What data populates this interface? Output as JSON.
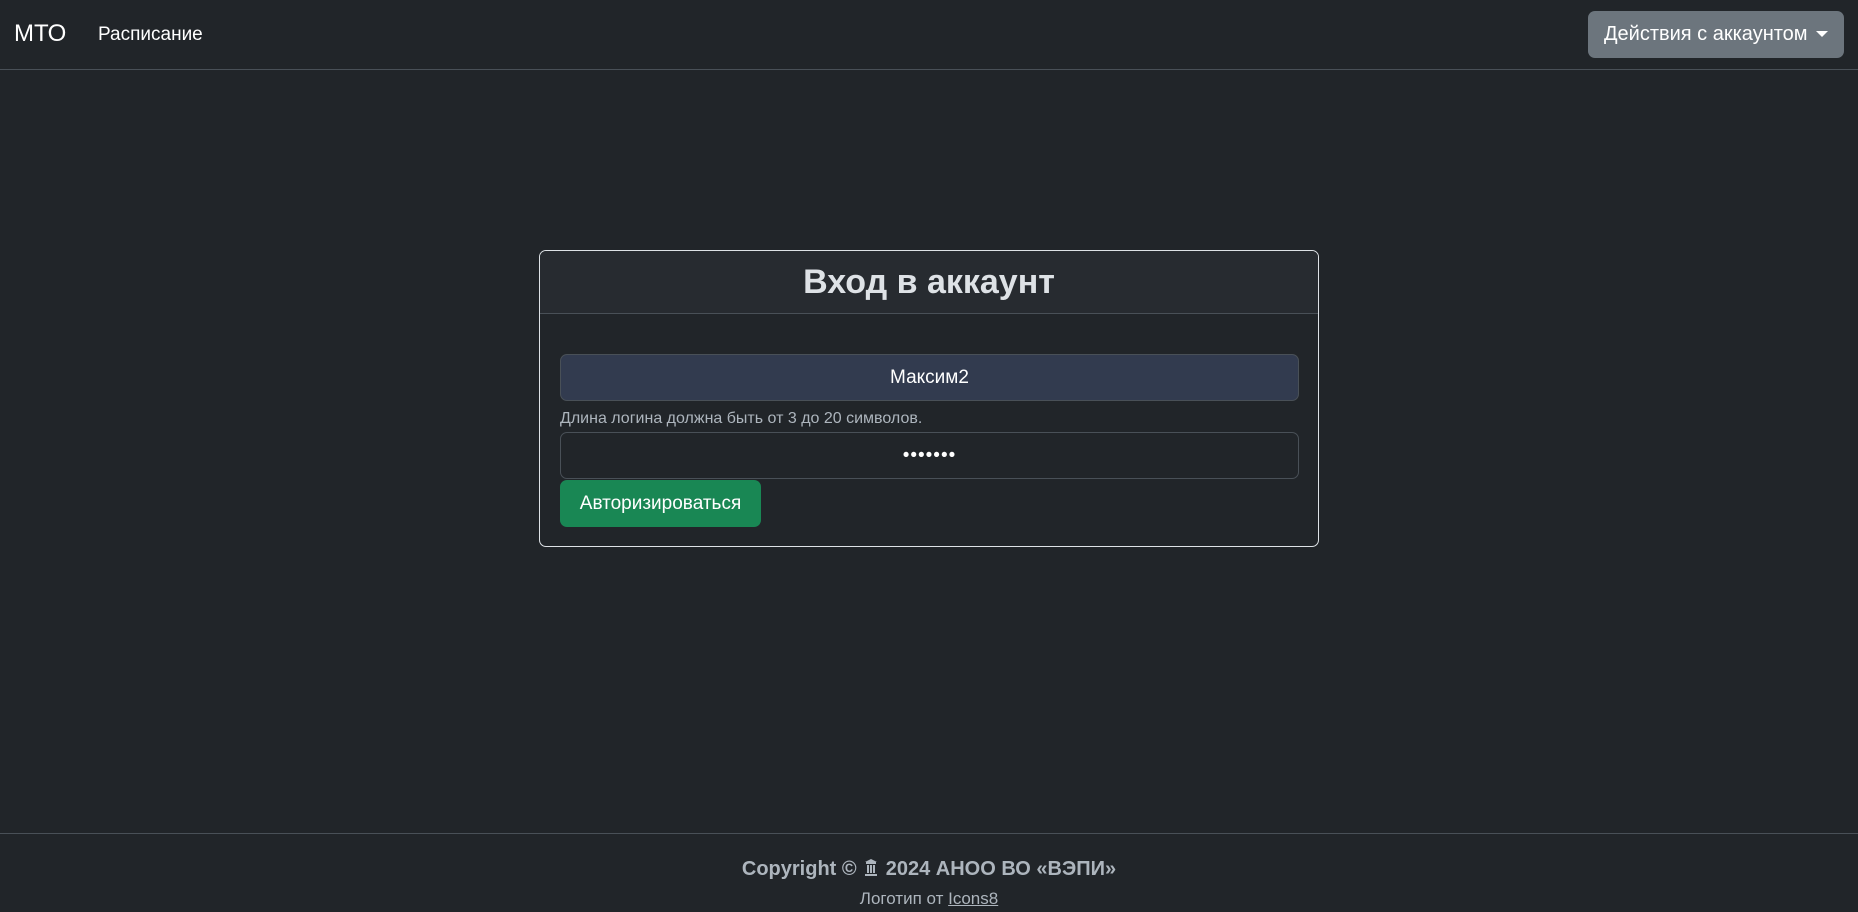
{
  "navbar": {
    "brand": "МТО",
    "links": [
      "Расписание"
    ],
    "account_button": "Действия с аккаунтом"
  },
  "login_card": {
    "title": "Вход в аккаунт",
    "login_value": "Максим2",
    "login_hint": "Длина логина должна быть от 3 до 20 символов.",
    "password_value": "*******",
    "submit_label": "Авторизироваться"
  },
  "footer": {
    "copyright_prefix": "Copyright ©",
    "copyright_suffix": "2024 АНОО ВО «ВЭПИ»",
    "credit_prefix": "Логотип от",
    "credit_link": "Icons8"
  },
  "colors": {
    "background": "#212529",
    "accent_success": "#198754",
    "secondary": "#6c757d"
  },
  "icons": [
    "caret-down-icon",
    "institution-logo-icon"
  ]
}
